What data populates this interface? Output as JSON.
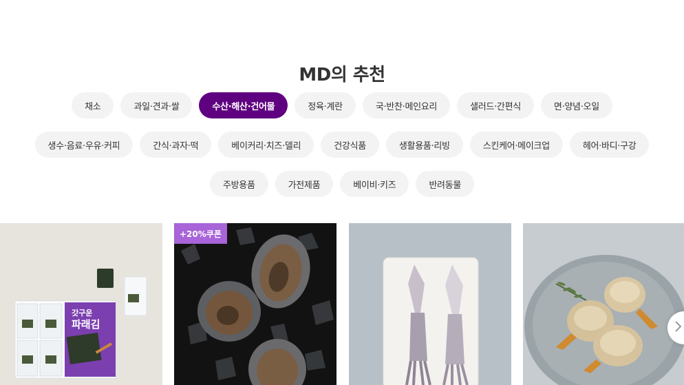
{
  "section": {
    "title": "MD의 추천"
  },
  "categories": {
    "row1": [
      "채소",
      "과일·견과·쌀",
      "수산·해산·건어물",
      "정육·계란",
      "국·반찬·메인요리",
      "샐러드·간편식",
      "면·양념·오일"
    ],
    "row2": [
      "생수·음료·우유·커피",
      "간식·과자·떡",
      "베이커리·치즈·델리",
      "건강식품",
      "생활용품·리빙",
      "스킨케어·메이크업",
      "헤어·바디·구강"
    ],
    "row3": [
      "주방용품",
      "가전제품",
      "베이비·키즈",
      "반려동물"
    ],
    "active": "수산·해산·건어물"
  },
  "products": [
    {
      "image": "seaweed-snack-package",
      "packaging_text": "갓구운 파래김",
      "badge": ""
    },
    {
      "image": "abalone-on-ice",
      "badge": "+20%쿠폰"
    },
    {
      "image": "squid-on-plate",
      "badge": ""
    },
    {
      "image": "clams-on-plate",
      "badge": ""
    }
  ],
  "colors": {
    "accent": "#5f0080",
    "chip_bg": "#f3f3f3",
    "badge_bg": "#a864d8"
  },
  "icons": {
    "next": "chevron-right-icon"
  }
}
